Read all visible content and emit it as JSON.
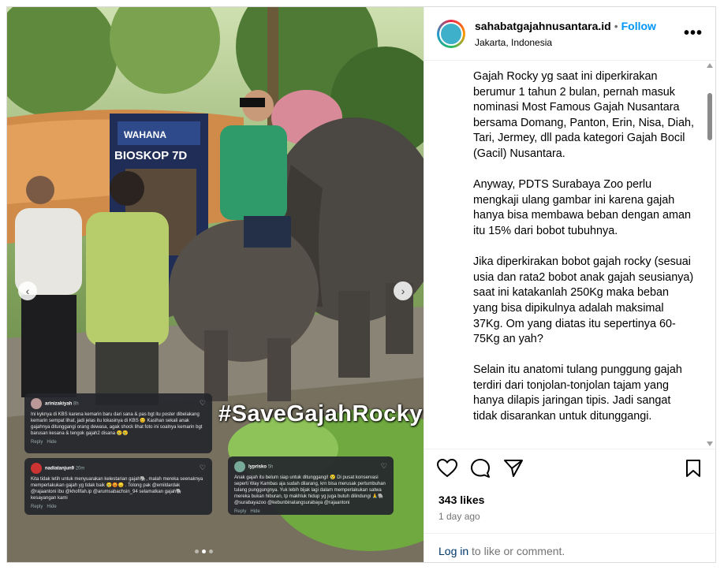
{
  "post": {
    "username": "sahabatgajahnusantara.id",
    "separator": "•",
    "follow_label": "Follow",
    "location": "Jakarta, Indonesia",
    "more_label": "•••"
  },
  "media": {
    "hashtag": "#SaveGajahRocky",
    "sign_text_1": "WAHANA",
    "sign_text_2": "BIOSKOP 7D",
    "comments": [
      {
        "user": "arinizakiyah",
        "time": "8h",
        "text": "Ini kyknya di KBS karena kemarin baru dari sana & pas bgt itu poster dibelakang kemarin sempat lihat, jadi jelas itu lokasinya di KBS 😊 Kasihan sekali anak gajahnya ditunggangi orang dewasa, agak shock lihat foto ini soalnya kemarin bgt barusan kesana & tengok gajah2 disana 😢😢",
        "reply": "Reply",
        "hide": "Hide"
      },
      {
        "user": "nadiatanjun9",
        "time": "20m",
        "text": "Kita tidak letih untuk menyuarakan kelestarian gajah🐘, malah mereka seenaknya memperlakukan gajah yg tidak baik 😢😡😞 . Tolong pak @emildardak @rajaantoni ibu @khofifah.ip @arumsabachsin_94 selamatkan gajah🐘 kesayangan kami",
        "reply": "Reply",
        "hide": "Hide"
      },
      {
        "user": "lyprisko",
        "time": "5h",
        "text": "Anak gajah itu belum siap untuk ditunggangi! 😢 Di pusat konservasi seperti Way Kambas aja sudah dilarang, krn bisa merusak pertumbuhan tulang punggungnya. Yuk lebih bijak lagi dalam memperlakukan satwa mereka bukan hiburan, tp makhluk hidup yg juga butuh dilindungi 🙏🐘 @surabayazoo @kebunbinatangsurabaya @rajaantoni",
        "reply": "Reply",
        "hide": "Hide"
      }
    ]
  },
  "caption": {
    "paragraphs": [
      "Gajah Rocky yg saat ini diperkirakan berumur 1 tahun 2 bulan, pernah masuk nominasi Most Famous Gajah Nusantara bersama Domang, Panton, Erin, Nisa, Diah, Tari, Jermey, dll pada kategori Gajah Bocil (Gacil) Nusantara.",
      "Anyway, PDTS Surabaya Zoo perlu mengkaji ulang gambar ini karena gajah hanya bisa membawa beban dengan aman itu 15% dari bobot tubuhnya.",
      "Jika diperkirakan bobot gajah rocky (sesuai usia dan rata2 bobot anak gajah seusianya) saat ini katakanlah 250Kg maka beban yang bisa dipikulnya adalah maksimal 37Kg. Om yang diatas itu sepertinya 60-75Kg an yah?",
      "Selain itu anatomi tulang punggung gajah terdiri dari tonjolan-tonjolan tajam yang hanya dilapis jaringan tipis. Jadi sangat tidak disarankan untuk ditunggangi."
    ]
  },
  "engagement": {
    "likes": "343 likes",
    "ago": "1 day ago",
    "login_link": "Log in",
    "login_rest": " to like or comment."
  },
  "icons": {
    "like": "heart-icon",
    "comment": "comment-icon",
    "share": "share-icon",
    "save": "bookmark-icon",
    "prev": "chevron-left-icon",
    "next": "chevron-right-icon"
  },
  "colors": {
    "follow": "#0095f6",
    "link": "#00376b",
    "muted": "#737373"
  }
}
